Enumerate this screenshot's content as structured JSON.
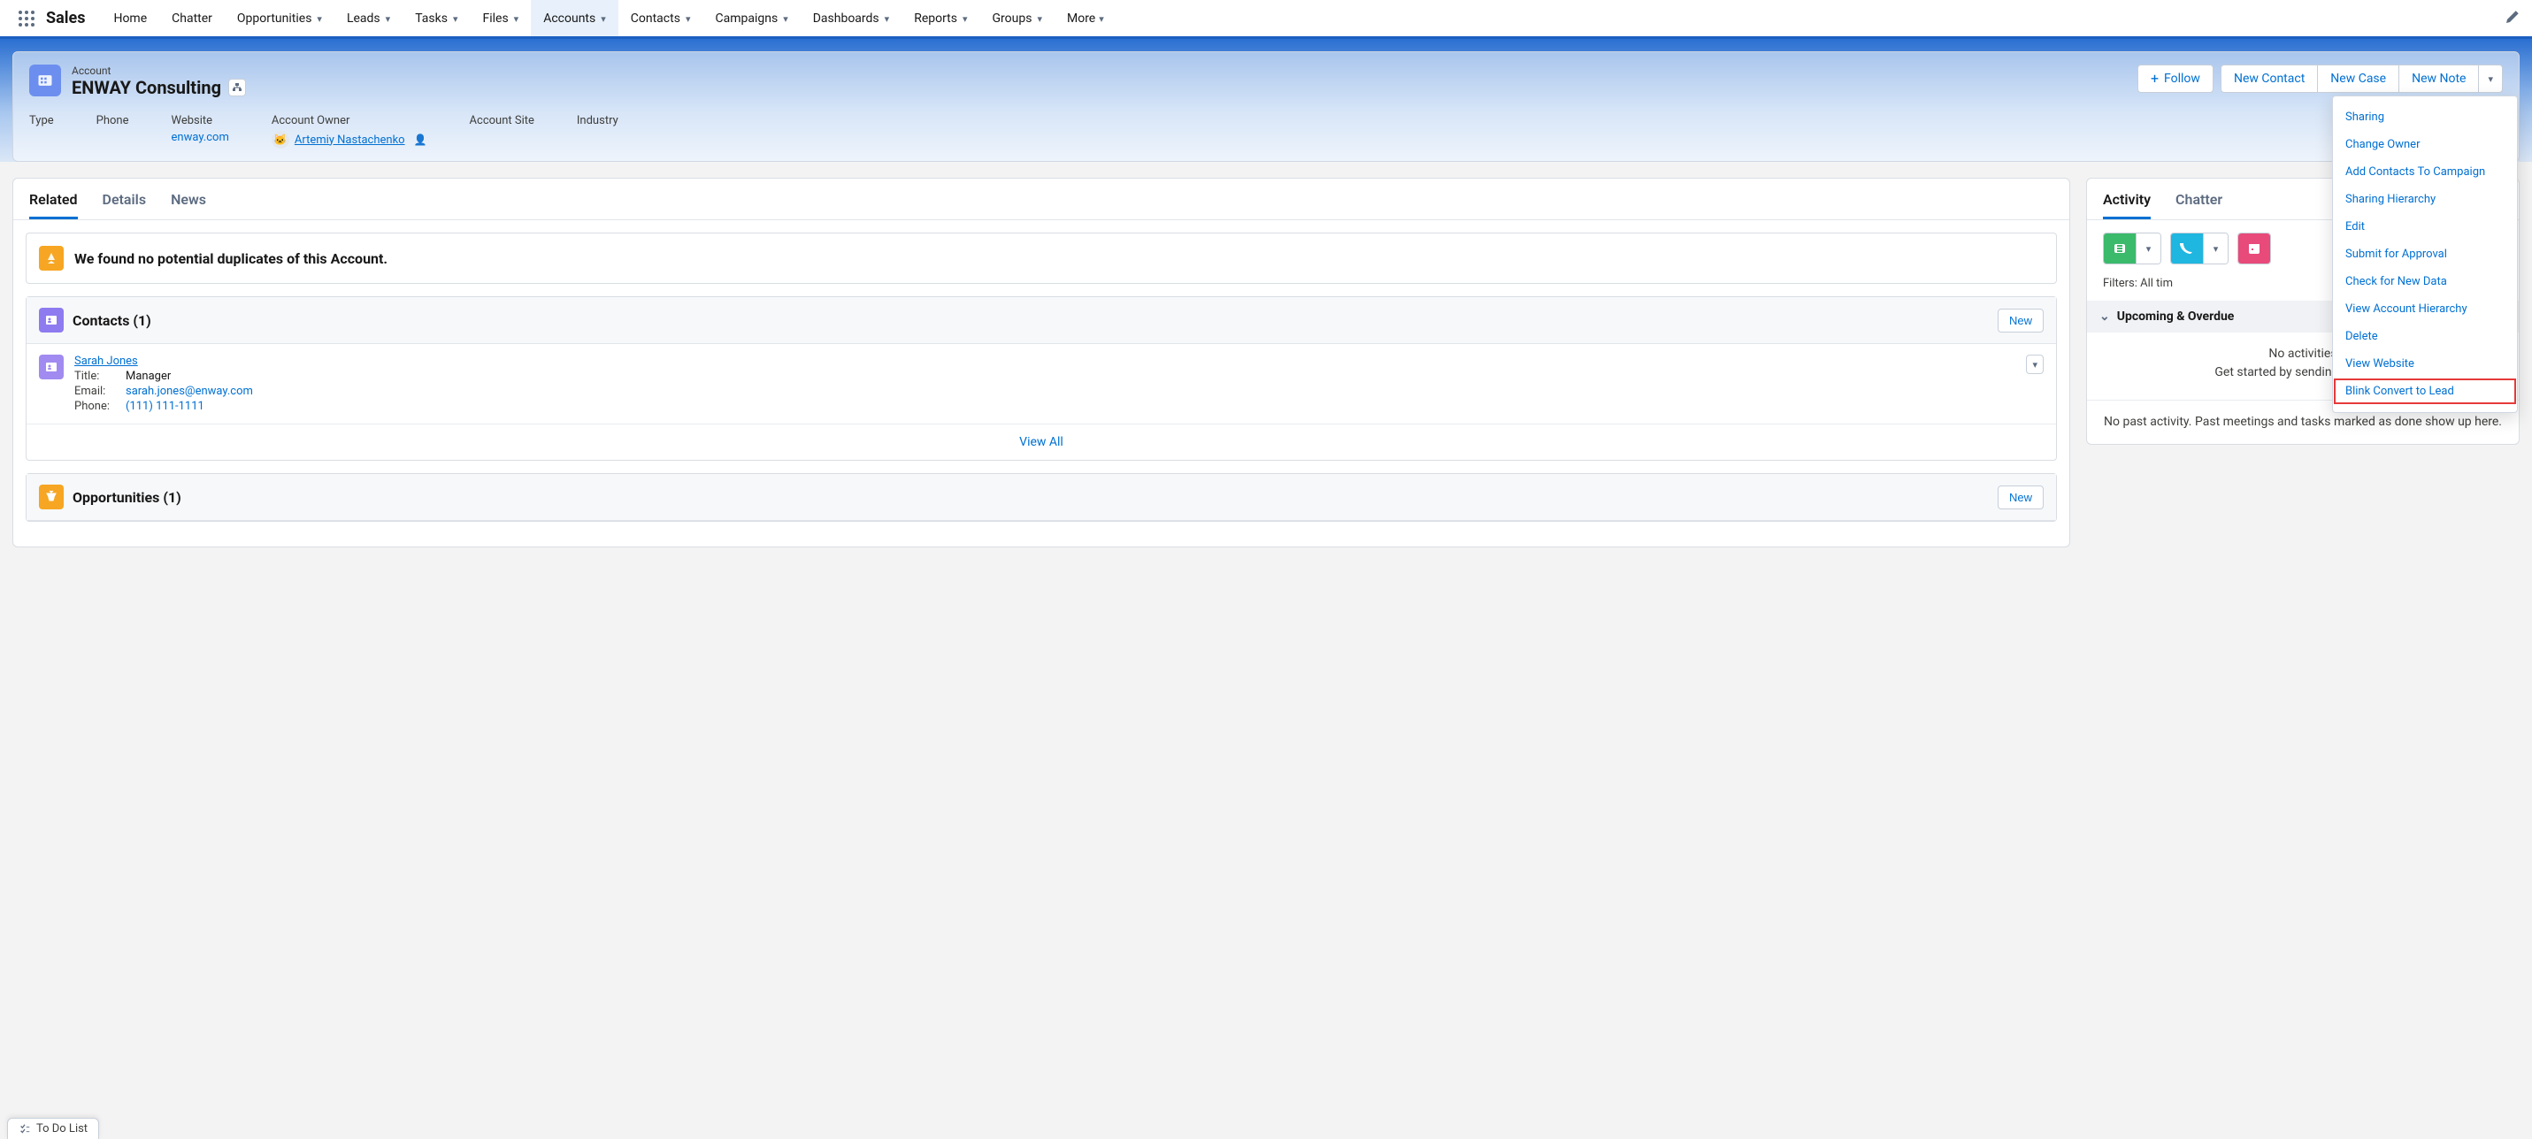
{
  "app_name": "Sales",
  "nav": {
    "items": [
      {
        "label": "Home",
        "chevron": false
      },
      {
        "label": "Chatter",
        "chevron": false
      },
      {
        "label": "Opportunities",
        "chevron": true
      },
      {
        "label": "Leads",
        "chevron": true
      },
      {
        "label": "Tasks",
        "chevron": true
      },
      {
        "label": "Files",
        "chevron": true
      },
      {
        "label": "Accounts",
        "chevron": true,
        "active": true
      },
      {
        "label": "Contacts",
        "chevron": true
      },
      {
        "label": "Campaigns",
        "chevron": true
      },
      {
        "label": "Dashboards",
        "chevron": true
      },
      {
        "label": "Reports",
        "chevron": true
      },
      {
        "label": "Groups",
        "chevron": true
      }
    ],
    "more_label": "More"
  },
  "record": {
    "object_label": "Account",
    "name": "ENWAY Consulting",
    "actions": {
      "follow": "Follow",
      "new_contact": "New Contact",
      "new_case": "New Case",
      "new_note": "New Note"
    },
    "fields": {
      "type_label": "Type",
      "type_value": "",
      "phone_label": "Phone",
      "phone_value": "",
      "website_label": "Website",
      "website_value": "enway.com",
      "owner_label": "Account Owner",
      "owner_value": "Artemiy Nastachenko",
      "site_label": "Account Site",
      "site_value": "",
      "industry_label": "Industry",
      "industry_value": ""
    }
  },
  "left_tabs": {
    "related": "Related",
    "details": "Details",
    "news": "News"
  },
  "duplicates_message": "We found no potential duplicates of this Account.",
  "contacts": {
    "header": "Contacts (1)",
    "new_label": "New",
    "item": {
      "name": "Sarah Jones",
      "title_label": "Title:",
      "title_value": "Manager",
      "email_label": "Email:",
      "email_value": "sarah.jones@enway.com",
      "phone_label": "Phone:",
      "phone_value": "(111) 111-1111"
    },
    "view_all": "View All"
  },
  "opportunities": {
    "header": "Opportunities (1)",
    "new_label": "New"
  },
  "right_tabs": {
    "activity": "Activity",
    "chatter": "Chatter"
  },
  "activity": {
    "filters_prefix": "Filters: All tim",
    "section_header": "Upcoming & Overdue",
    "empty_line1": "No activities",
    "empty_line2": "Get started by sending an email,",
    "past": "No past activity. Past meetings and tasks marked as done show up here."
  },
  "dropdown": {
    "items": [
      "Sharing",
      "Change Owner",
      "Add Contacts To Campaign",
      "Sharing Hierarchy",
      "Edit",
      "Submit for Approval",
      "Check for New Data",
      "View Account Hierarchy",
      "Delete",
      "View Website",
      "Blink Convert to Lead"
    ],
    "highlight_index": 10
  },
  "todo_stub": "To Do List"
}
